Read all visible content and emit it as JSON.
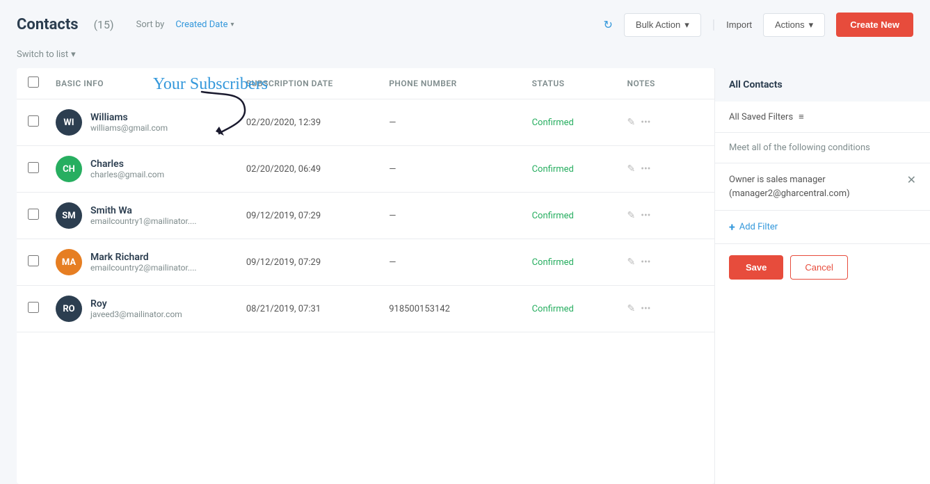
{
  "header": {
    "title": "Contacts",
    "count": "(15)",
    "sort_label": "Sort by",
    "sort_value": "Created Date",
    "bulk_action_label": "Bulk Action",
    "import_label": "Import",
    "actions_label": "Actions",
    "create_new_label": "Create New",
    "switch_to_list": "Switch to list"
  },
  "annotation": {
    "text": "Your Subscribers"
  },
  "table": {
    "columns": {
      "basic_info": "Basic Info",
      "subscription_date": "Subscription Date",
      "phone_number": "Phone Number",
      "status": "Status",
      "notes": "Notes"
    },
    "rows": [
      {
        "initials": "WI",
        "avatar_color": "#2c3e50",
        "name": "Williams",
        "email": "williams@gmail.com",
        "subscription_date": "02/20/2020, 12:39",
        "phone": "—",
        "status": "Confirmed"
      },
      {
        "initials": "CH",
        "avatar_color": "#27ae60",
        "name": "Charles",
        "email": "charles@gmail.com",
        "subscription_date": "02/20/2020, 06:49",
        "phone": "—",
        "status": "Confirmed"
      },
      {
        "initials": "SM",
        "avatar_color": "#2c3e50",
        "name": "Smith Wa",
        "email": "emailcountry1@mailinator....",
        "subscription_date": "09/12/2019, 07:29",
        "phone": "—",
        "status": "Confirmed"
      },
      {
        "initials": "MA",
        "avatar_color": "#e67e22",
        "name": "Mark Richard",
        "email": "emailcountry2@mailinator....",
        "subscription_date": "09/12/2019, 07:29",
        "phone": "—",
        "status": "Confirmed"
      },
      {
        "initials": "RO",
        "avatar_color": "#2c3e50",
        "name": "Roy",
        "email": "javeed3@mailinator.com",
        "subscription_date": "08/21/2019, 07:31",
        "phone": "918500153142",
        "status": "Confirmed"
      }
    ]
  },
  "right_panel": {
    "all_contacts_label": "All Contacts",
    "all_saved_filters_label": "All Saved Filters",
    "conditions_text": "Meet all of the following conditions",
    "filter_condition": "Owner is sales manager\n(manager2@gharcentral.com)",
    "add_filter_label": "Add Filter",
    "save_label": "Save",
    "cancel_label": "Cancel"
  }
}
